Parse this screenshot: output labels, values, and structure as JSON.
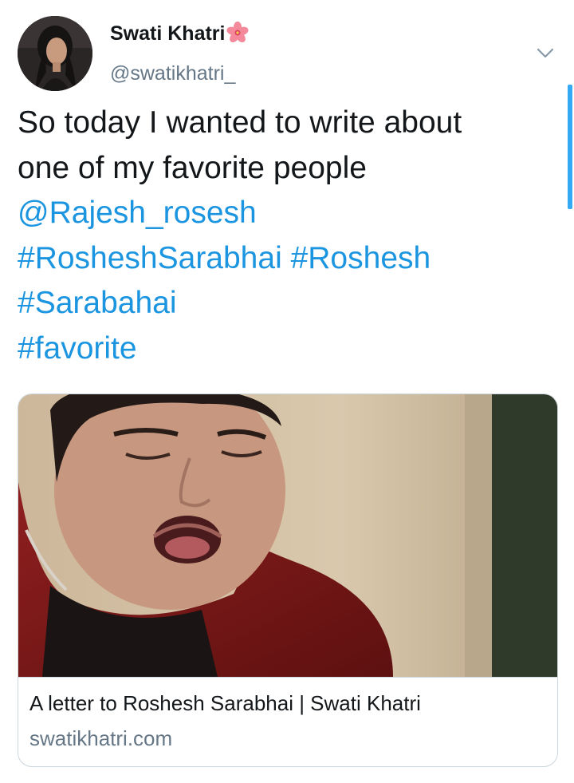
{
  "author": {
    "display_name": "Swati Khatri",
    "emoji_icon": "hibiscus-flower-icon",
    "handle": "@swatikhatri_"
  },
  "tweet": {
    "line1": "So today I wanted to write about",
    "line2": "one of my favorite people",
    "mention": "@Rajesh_rosesh",
    "hashtag1": "#RosheshSarabhai",
    "hashtag2": "#Roshesh",
    "hashtag3": "#Sarabahai",
    "hashtag4": "#favorite"
  },
  "link_card": {
    "title": "A letter to Roshesh Sarabhai | Swati Khatri",
    "domain": "swatikhatri.com"
  },
  "colors": {
    "link": "#1b95e0",
    "text": "#14171a",
    "secondary": "#657786",
    "border": "#ccd6dd"
  }
}
